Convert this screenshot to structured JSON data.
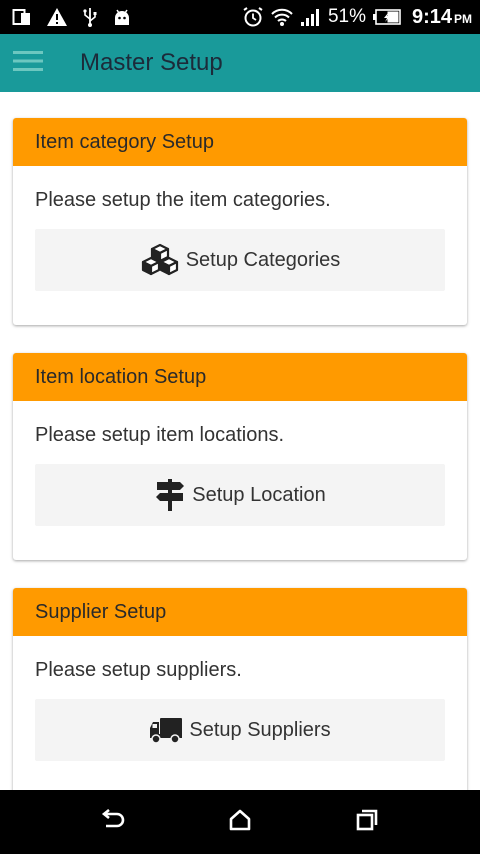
{
  "status_bar": {
    "battery_percent": "51%",
    "time": "9:14",
    "ampm": "PM",
    "icons": [
      "copy-icon",
      "warning-icon",
      "usb-icon",
      "android-icon",
      "alarm-icon",
      "wifi-icon",
      "signal-icon",
      "battery-icon"
    ]
  },
  "app_bar": {
    "title": "Master Setup",
    "menu_icon": "hamburger-menu-icon",
    "color": "#199a9a"
  },
  "cards": [
    {
      "header": "Item category Setup",
      "description": "Please setup the item categories.",
      "button_label": "Setup Categories",
      "button_icon": "cubes-icon"
    },
    {
      "header": "Item location Setup",
      "description": "Please setup item locations.",
      "button_label": "Setup Location",
      "button_icon": "signpost-icon"
    },
    {
      "header": "Supplier Setup",
      "description": "Please setup suppliers.",
      "button_label": "Setup Suppliers",
      "button_icon": "truck-icon"
    }
  ],
  "card_header_color": "#ff9a00",
  "nav_bar": {
    "buttons": [
      "back-icon",
      "home-icon",
      "recents-icon"
    ]
  }
}
